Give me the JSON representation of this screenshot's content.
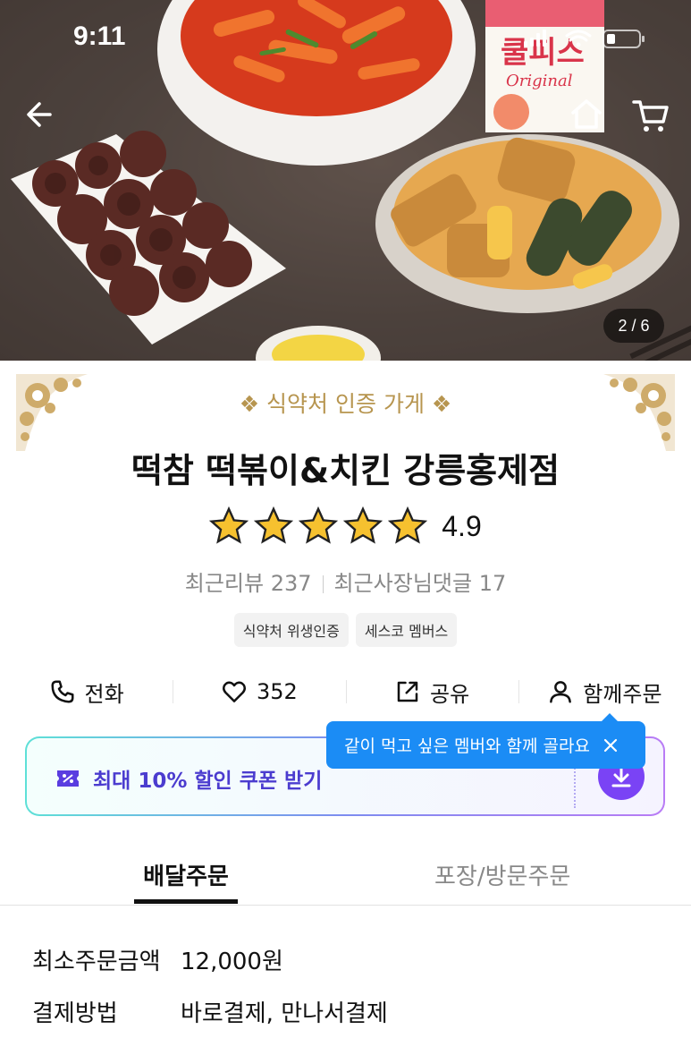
{
  "status_bar": {
    "time": "9:11"
  },
  "hero": {
    "image_counter": "2 / 6"
  },
  "store": {
    "certified_badge": "식약처 인증 가게",
    "name": "떡참 떡볶이&치킨 강릉홍제점",
    "rating": "4.9",
    "rating_stars": 5,
    "recent_reviews_label": "최근리뷰 237",
    "recent_owner_replies_label": "최근사장님댓글 17",
    "tags": [
      "식약처 위생인증",
      "세스코 멤버스"
    ]
  },
  "actions": {
    "call_label": "전화",
    "likes_count": "352",
    "share_label": "공유",
    "group_order_label": "함께주문"
  },
  "tooltip": {
    "text": "같이 먹고 싶은 멤버와 함께 골라요"
  },
  "coupon": {
    "prefix": "최대 ",
    "highlight": "10%",
    "suffix": " 할인 쿠폰 받기"
  },
  "tabs": {
    "delivery": "배달주문",
    "pickup": "포장/방문주문"
  },
  "info": {
    "min_order_label": "최소주문금액",
    "min_order_value": "12,000원",
    "payment_label": "결제방법",
    "payment_value": "바로결제, 만나서결제"
  },
  "colors": {
    "accent_purple": "#7a43f5",
    "tooltip_blue": "#1b8cf5",
    "gold": "#b7954f"
  },
  "icons": [
    "back-arrow-icon",
    "home-icon",
    "cart-icon",
    "phone-icon",
    "heart-icon",
    "share-icon",
    "person-icon",
    "coupon-icon",
    "download-icon",
    "close-icon",
    "star-icon",
    "ornament"
  ]
}
